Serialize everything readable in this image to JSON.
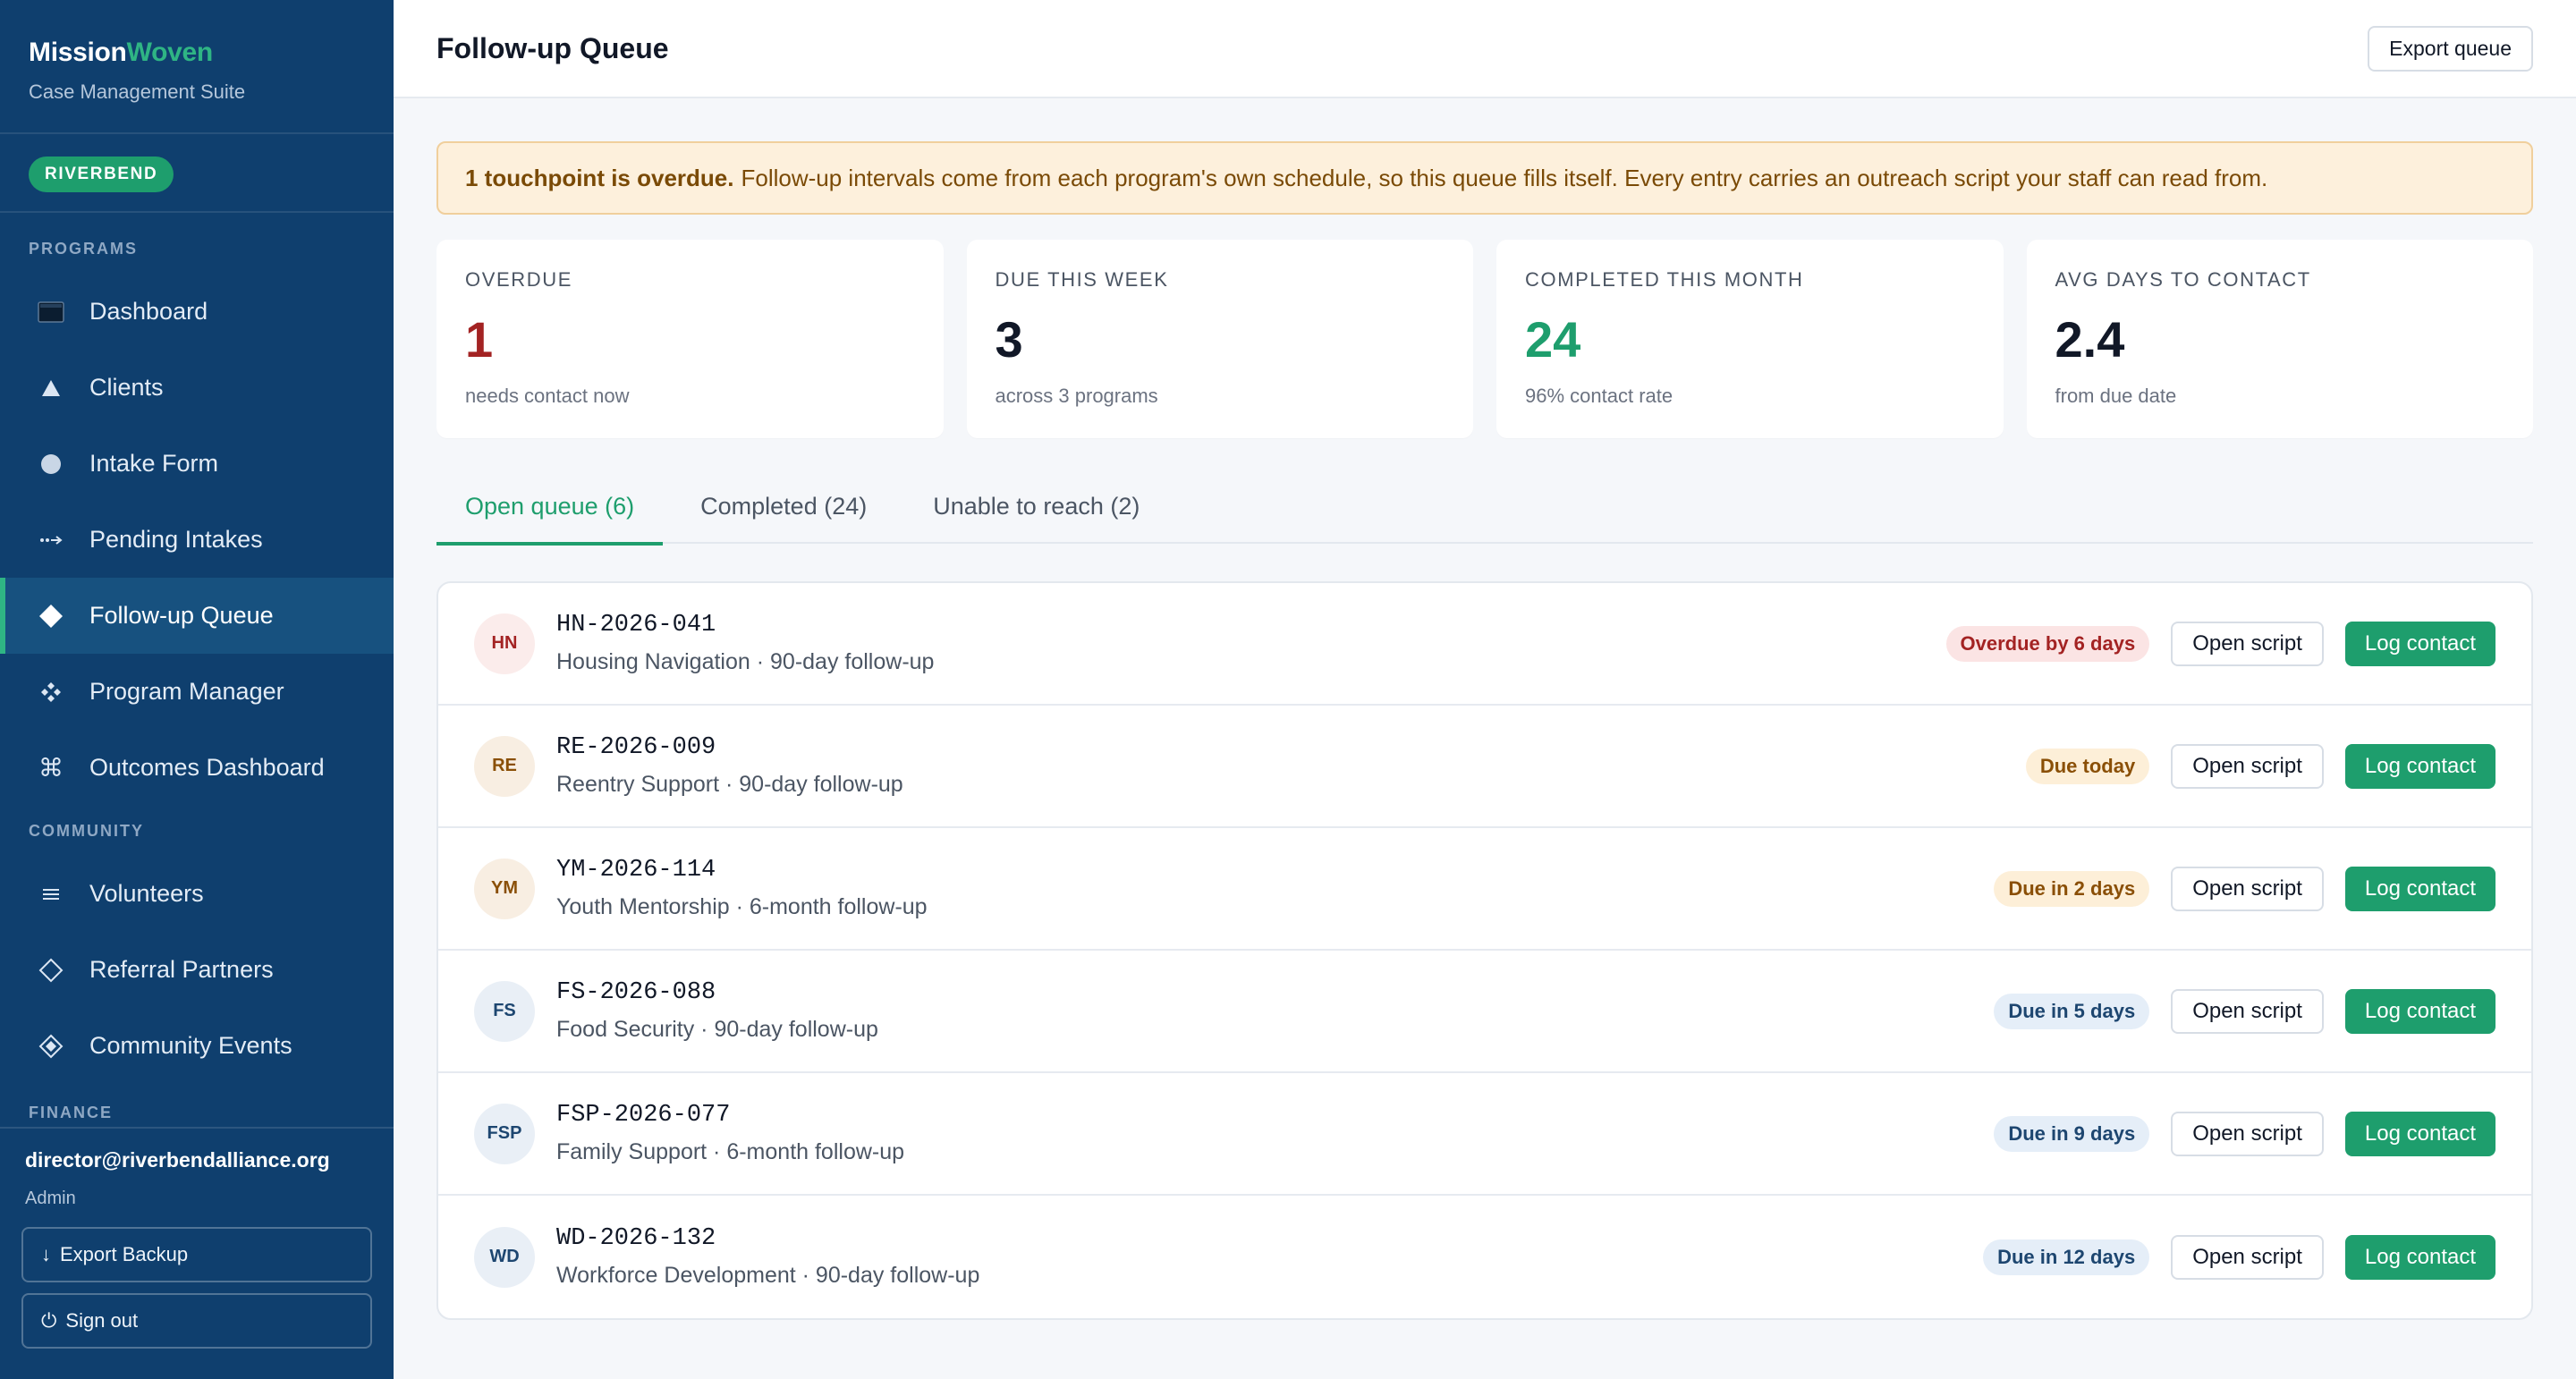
{
  "brand": {
    "name_part1": "Mission",
    "name_part2": "Woven",
    "subtitle": "Case Management Suite",
    "accent_color": "#2fb584"
  },
  "org": {
    "badge": "RIVERBEND"
  },
  "sidebar": {
    "sections": {
      "programs": "PROGRAMS",
      "community": "COMMUNITY",
      "finance": "FINANCE"
    },
    "items": [
      {
        "label": "Dashboard",
        "icon": "dashboard-square-icon"
      },
      {
        "label": "Clients",
        "icon": "triangle-icon"
      },
      {
        "label": "Intake Form",
        "icon": "circle-icon"
      },
      {
        "label": "Pending Intakes",
        "icon": "dotted-arrow-icon"
      },
      {
        "label": "Follow-up Queue",
        "icon": "diamond-icon",
        "active": true
      },
      {
        "label": "Program Manager",
        "icon": "four-diamonds-icon"
      },
      {
        "label": "Outcomes Dashboard",
        "icon": "command-icon"
      },
      {
        "label": "Volunteers",
        "icon": "menu-lines-icon"
      },
      {
        "label": "Referral Partners",
        "icon": "diamond-outline-icon"
      },
      {
        "label": "Community Events",
        "icon": "diamond-dot-icon"
      }
    ],
    "footer": {
      "email": "director@riverbendalliance.org",
      "role": "Admin",
      "export_backup": "Export Backup",
      "sign_out": "Sign out"
    }
  },
  "header": {
    "title": "Follow-up Queue",
    "export_label": "Export queue"
  },
  "alert": {
    "bold": "1 touchpoint is overdue.",
    "text": "Follow-up intervals come from each program's own schedule, so this queue fills itself. Every entry carries an outreach script your staff can read from."
  },
  "stats": [
    {
      "label": "OVERDUE",
      "value": "1",
      "sub": "needs contact now",
      "tone": "red"
    },
    {
      "label": "DUE THIS WEEK",
      "value": "3",
      "sub": "across 3 programs",
      "tone": "default"
    },
    {
      "label": "COMPLETED THIS MONTH",
      "value": "24",
      "sub": "96% contact rate",
      "tone": "green"
    },
    {
      "label": "AVG DAYS TO CONTACT",
      "value": "2.4",
      "sub": "from due date",
      "tone": "default"
    }
  ],
  "tabs": [
    {
      "label": "Open queue (6)",
      "active": true
    },
    {
      "label": "Completed (24)"
    },
    {
      "label": "Unable to reach (2)"
    }
  ],
  "queue": {
    "open_script_label": "Open script",
    "log_contact_label": "Log contact",
    "rows": [
      {
        "initials": "HN",
        "case_id": "HN-2026-041",
        "meta": "Housing Navigation · 90-day follow-up",
        "status": "Overdue by 6 days",
        "tone": "red"
      },
      {
        "initials": "RE",
        "case_id": "RE-2026-009",
        "meta": "Reentry Support · 90-day follow-up",
        "status": "Due today",
        "tone": "amber"
      },
      {
        "initials": "YM",
        "case_id": "YM-2026-114",
        "meta": "Youth Mentorship · 6-month follow-up",
        "status": "Due in 2 days",
        "tone": "amber"
      },
      {
        "initials": "FS",
        "case_id": "FS-2026-088",
        "meta": "Food Security · 90-day follow-up",
        "status": "Due in 5 days",
        "tone": "blue"
      },
      {
        "initials": "FSP",
        "case_id": "FSP-2026-077",
        "meta": "Family Support · 6-month follow-up",
        "status": "Due in 9 days",
        "tone": "blue"
      },
      {
        "initials": "WD",
        "case_id": "WD-2026-132",
        "meta": "Workforce Development · 90-day follow-up",
        "status": "Due in 12 days",
        "tone": "blue"
      }
    ]
  },
  "colors": {
    "sidebar_bg": "#0f3f6e",
    "primary_green": "#1e9e6d",
    "overdue_red": "#a32323",
    "warning_amber": "#8a4f06"
  }
}
